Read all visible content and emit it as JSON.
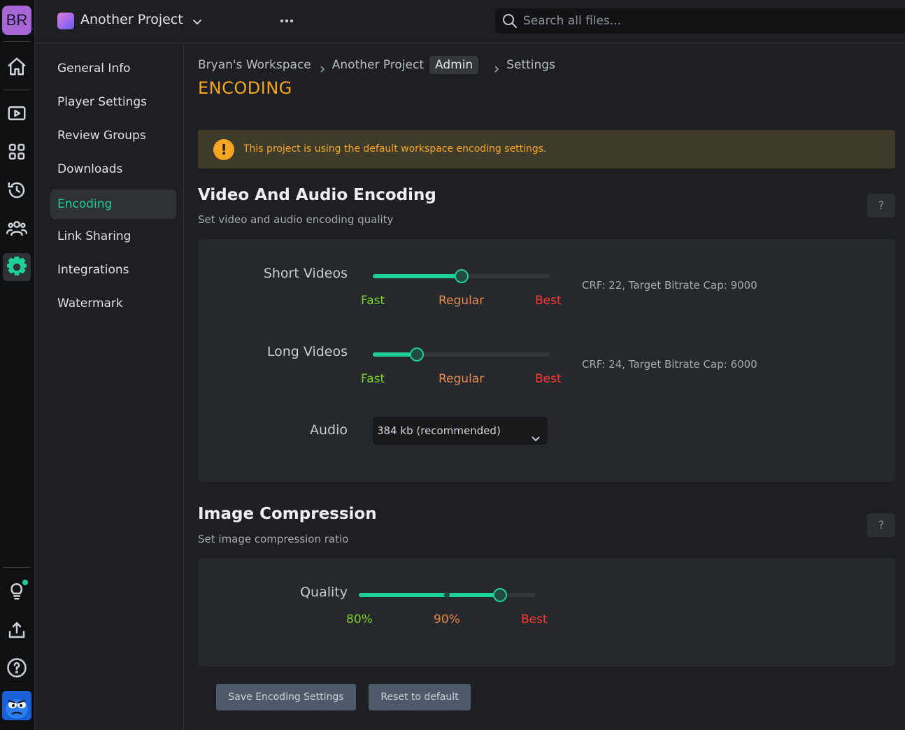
{
  "rail": {
    "avatar_initials": "BR",
    "items": [
      {
        "icon": "home-icon"
      },
      {
        "icon": "play-icon"
      },
      {
        "icon": "grid-icon"
      },
      {
        "icon": "history-icon"
      },
      {
        "icon": "users-icon"
      },
      {
        "icon": "gear-icon",
        "active": true
      }
    ],
    "bottom": [
      {
        "icon": "lightbulb-icon",
        "badge": true
      },
      {
        "icon": "upload-icon"
      },
      {
        "icon": "help-icon"
      }
    ]
  },
  "topbar": {
    "project_name": "Another Project",
    "search_placeholder": "Search all files..."
  },
  "subnav": {
    "items": [
      {
        "label": "General Info"
      },
      {
        "label": "Player Settings"
      },
      {
        "label": "Review Groups"
      },
      {
        "label": "Downloads"
      },
      {
        "label": "Encoding",
        "active": true
      },
      {
        "label": "Link Sharing"
      },
      {
        "label": "Integrations"
      },
      {
        "label": "Watermark"
      }
    ]
  },
  "breadcrumb": {
    "workspace": "Bryan's Workspace",
    "project": "Another Project",
    "badge": "Admin",
    "current": "Settings"
  },
  "page_title": "ENCODING",
  "alert_text": "This project is using the default workspace encoding settings.",
  "video_audio": {
    "title": "Video And Audio Encoding",
    "subtitle": "Set video and audio encoding quality",
    "help": "?",
    "short_videos": {
      "label": "Short Videos",
      "level": 0.5,
      "ticks": [
        "Fast",
        "Regular",
        "Best"
      ],
      "info": "CRF: 22, Target Bitrate Cap: 9000"
    },
    "long_videos": {
      "label": "Long Videos",
      "level": 0.25,
      "ticks": [
        "Fast",
        "Regular",
        "Best"
      ],
      "info": "CRF: 24, Target Bitrate Cap: 6000"
    },
    "audio": {
      "label": "Audio",
      "value": "384 kb (recommended)"
    }
  },
  "image_compression": {
    "title": "Image Compression",
    "subtitle": "Set image compression ratio",
    "help": "?",
    "quality": {
      "label": "Quality",
      "level": 0.8,
      "ticks": [
        "80%",
        "90%",
        "Best"
      ]
    }
  },
  "buttons": {
    "save": "Save Encoding Settings",
    "reset": "Reset to default"
  },
  "colors": {
    "accent": "#1fcf9a",
    "warning": "#f5a623",
    "fast": "#7ed321",
    "regular": "#e8894a",
    "best": "#ff3b30"
  }
}
